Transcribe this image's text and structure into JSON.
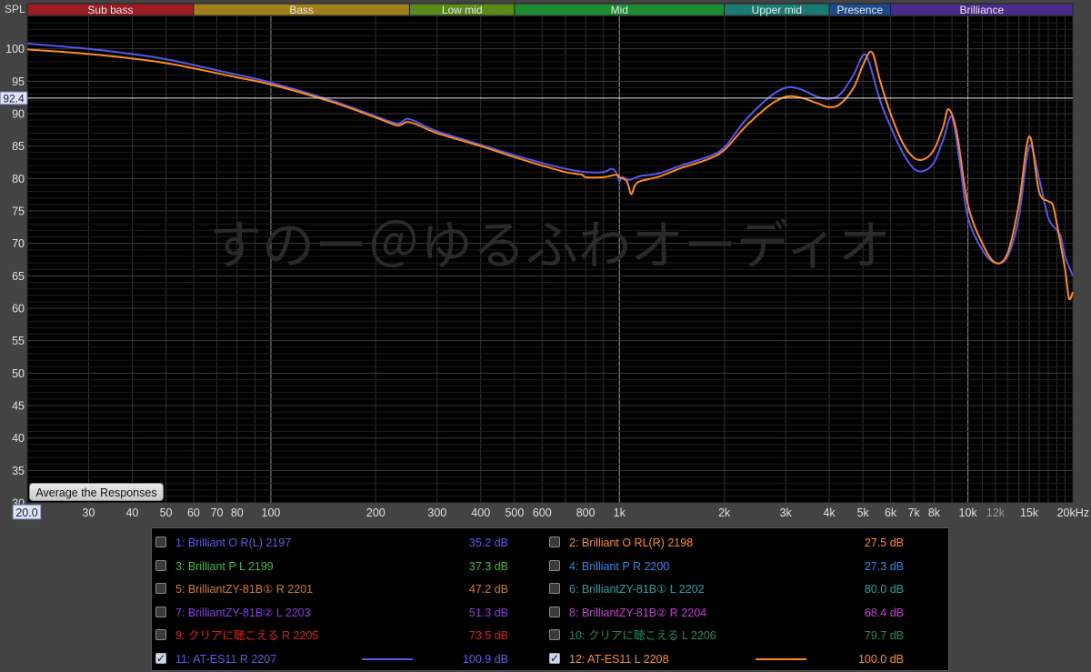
{
  "bands": [
    {
      "label": "Sub bass",
      "color": "#9c1c24",
      "from": 20,
      "to": 60
    },
    {
      "label": "Bass",
      "color": "#a0801c",
      "from": 60,
      "to": 250
    },
    {
      "label": "Low mid",
      "color": "#5a8a1a",
      "from": 250,
      "to": 500
    },
    {
      "label": "Mid",
      "color": "#1e8a32",
      "from": 500,
      "to": 2000
    },
    {
      "label": "Upper mid",
      "color": "#1c7a72",
      "from": 2000,
      "to": 4000
    },
    {
      "label": "Presence",
      "color": "#1c4a8a",
      "from": 4000,
      "to": 6000
    },
    {
      "label": "Brilliance",
      "color": "#4a2a8a",
      "from": 6000,
      "to": 20000
    }
  ],
  "avg_button_label": "Average the Responses",
  "chart_data": {
    "type": "line",
    "xlabel": "",
    "ylabel": "SPL",
    "xscale": "log",
    "xlim": [
      20,
      20000
    ],
    "ylim": [
      30,
      105
    ],
    "cursor_value": "92.4",
    "cursor_freq_label": "20.0",
    "y_ticks": [
      30,
      35,
      40,
      45,
      50,
      55,
      60,
      65,
      70,
      75,
      80,
      85,
      90,
      95,
      100
    ],
    "x_ticks": [
      {
        "v": 30,
        "t": "30"
      },
      {
        "v": 40,
        "t": "40"
      },
      {
        "v": 50,
        "t": "50"
      },
      {
        "v": 60,
        "t": "60"
      },
      {
        "v": 70,
        "t": "70"
      },
      {
        "v": 80,
        "t": "80"
      },
      {
        "v": 100,
        "t": "100"
      },
      {
        "v": 200,
        "t": "200"
      },
      {
        "v": 300,
        "t": "300"
      },
      {
        "v": 400,
        "t": "400"
      },
      {
        "v": 500,
        "t": "500"
      },
      {
        "v": 600,
        "t": "600"
      },
      {
        "v": 800,
        "t": "800"
      },
      {
        "v": 1000,
        "t": "1k"
      },
      {
        "v": 2000,
        "t": "2k"
      },
      {
        "v": 3000,
        "t": "3k"
      },
      {
        "v": 4000,
        "t": "4k"
      },
      {
        "v": 5000,
        "t": "5k"
      },
      {
        "v": 6000,
        "t": "6k"
      },
      {
        "v": 7000,
        "t": "7k"
      },
      {
        "v": 8000,
        "t": "8k"
      },
      {
        "v": 10000,
        "t": "10k"
      },
      {
        "v": 12000,
        "t": "12k"
      },
      {
        "v": 15000,
        "t": "15k"
      },
      {
        "v": 20000,
        "t": "20kHz"
      }
    ],
    "watermark": "すのー＠ゆるふわオーディオ",
    "series": [
      {
        "name": "11: AT-ES11  R 2207",
        "color": "#5555ee",
        "points": [
          [
            20,
            100.8
          ],
          [
            30,
            100
          ],
          [
            40,
            99.2
          ],
          [
            50,
            98.4
          ],
          [
            60,
            97.5
          ],
          [
            80,
            96
          ],
          [
            100,
            94.8
          ],
          [
            150,
            92
          ],
          [
            200,
            89.6
          ],
          [
            230,
            88.5
          ],
          [
            245,
            89.2
          ],
          [
            260,
            88.8
          ],
          [
            300,
            87.3
          ],
          [
            400,
            85.2
          ],
          [
            500,
            83.6
          ],
          [
            600,
            82.4
          ],
          [
            700,
            81.5
          ],
          [
            800,
            81
          ],
          [
            900,
            81
          ],
          [
            950,
            81.5
          ],
          [
            980,
            80.9
          ],
          [
            1000,
            79.6
          ],
          [
            1020,
            80.2
          ],
          [
            1070,
            79.8
          ],
          [
            1150,
            80.4
          ],
          [
            1300,
            80.8
          ],
          [
            1500,
            82
          ],
          [
            1800,
            83.4
          ],
          [
            2000,
            84.8
          ],
          [
            2300,
            89
          ],
          [
            2700,
            92.6
          ],
          [
            3000,
            94
          ],
          [
            3300,
            93.8
          ],
          [
            3700,
            92.6
          ],
          [
            4000,
            92.3
          ],
          [
            4300,
            93
          ],
          [
            4700,
            96
          ],
          [
            5000,
            99
          ],
          [
            5200,
            98
          ],
          [
            5600,
            92
          ],
          [
            6000,
            88
          ],
          [
            6500,
            84
          ],
          [
            7000,
            81.5
          ],
          [
            7500,
            81.2
          ],
          [
            8000,
            82.5
          ],
          [
            8500,
            86
          ],
          [
            9000,
            89.5
          ],
          [
            9500,
            82
          ],
          [
            10000,
            74
          ],
          [
            11000,
            69
          ],
          [
            12000,
            67
          ],
          [
            13000,
            68
          ],
          [
            14000,
            74
          ],
          [
            15000,
            85
          ],
          [
            16000,
            80
          ],
          [
            17000,
            74
          ],
          [
            18000,
            72
          ],
          [
            18500,
            71
          ],
          [
            19000,
            68
          ],
          [
            20000,
            65
          ]
        ]
      },
      {
        "name": "12: AT-ES11  L 2208",
        "color": "#ff8a1c",
        "points": [
          [
            20,
            99.9
          ],
          [
            30,
            99.2
          ],
          [
            40,
            98.5
          ],
          [
            50,
            97.8
          ],
          [
            60,
            97
          ],
          [
            80,
            95.6
          ],
          [
            100,
            94.5
          ],
          [
            150,
            91.8
          ],
          [
            200,
            89.4
          ],
          [
            230,
            88.2
          ],
          [
            245,
            88.7
          ],
          [
            260,
            88.4
          ],
          [
            300,
            87
          ],
          [
            400,
            85
          ],
          [
            500,
            83.3
          ],
          [
            600,
            82
          ],
          [
            700,
            81
          ],
          [
            780,
            80.6
          ],
          [
            800,
            80.2
          ],
          [
            900,
            80.2
          ],
          [
            980,
            80.6
          ],
          [
            1000,
            80.2
          ],
          [
            1050,
            79.6
          ],
          [
            1080,
            77.6
          ],
          [
            1110,
            79
          ],
          [
            1150,
            79.6
          ],
          [
            1300,
            80.3
          ],
          [
            1500,
            81.6
          ],
          [
            1800,
            83
          ],
          [
            2000,
            84.4
          ],
          [
            2300,
            88
          ],
          [
            2700,
            91.3
          ],
          [
            3000,
            92.6
          ],
          [
            3300,
            92.5
          ],
          [
            3700,
            91.6
          ],
          [
            4000,
            91
          ],
          [
            4300,
            91.5
          ],
          [
            4700,
            94
          ],
          [
            5000,
            97.5
          ],
          [
            5300,
            99.5
          ],
          [
            5600,
            95
          ],
          [
            6000,
            90
          ],
          [
            6500,
            85.5
          ],
          [
            7000,
            83.2
          ],
          [
            7500,
            83
          ],
          [
            8000,
            84.5
          ],
          [
            8500,
            88
          ],
          [
            8800,
            90.7
          ],
          [
            9300,
            87
          ],
          [
            10000,
            76
          ],
          [
            11000,
            70
          ],
          [
            12000,
            67
          ],
          [
            13000,
            68.5
          ],
          [
            14000,
            76
          ],
          [
            15000,
            86.5
          ],
          [
            16000,
            78
          ],
          [
            17000,
            76.5
          ],
          [
            17500,
            76
          ],
          [
            18000,
            73
          ],
          [
            19000,
            66
          ],
          [
            19500,
            61.5
          ],
          [
            20000,
            62.5
          ]
        ]
      }
    ]
  },
  "legend": {
    "entries": [
      {
        "label": "1: Brilliant O R(L) 2197",
        "value": "35.2 dB",
        "color": "#5a5aee",
        "checked": false,
        "swatch": false
      },
      {
        "label": "2: Brilliant O RL(R)  2198",
        "value": "27.5 dB",
        "color": "#ff8a1c",
        "checked": false,
        "swatch": false
      },
      {
        "label": "3: Brilliant P L 2199",
        "value": "37.3 dB",
        "color": "#3cb83c",
        "checked": false,
        "swatch": false
      },
      {
        "label": "4: Brilliant P R 2200",
        "value": "27.3 dB",
        "color": "#2a88e0",
        "checked": false,
        "swatch": false
      },
      {
        "label": "5: BrilliantZY-81B①  R 2201",
        "value": "47.2 dB",
        "color": "#d07a1a",
        "checked": false,
        "swatch": false
      },
      {
        "label": "6: BrilliantZY-81B①  L 2202",
        "value": "80.0 dB",
        "color": "#1fa0a0",
        "checked": false,
        "swatch": false
      },
      {
        "label": "7: BrilliantZY-81B②  L 2203",
        "value": "51.3 dB",
        "color": "#8a3ae0",
        "checked": false,
        "swatch": false
      },
      {
        "label": "8: BrilliantZY-81B②  R 2204",
        "value": "68.4 dB",
        "color": "#c83ad0",
        "checked": false,
        "swatch": false
      },
      {
        "label": "9: クリアに聴こえる  R 2205",
        "value": "73.5 dB",
        "color": "#d42020",
        "checked": false,
        "swatch": false
      },
      {
        "label": "10: クリアに聴こえる  L 2206",
        "value": "79.7 dB",
        "color": "#1f8a5a",
        "checked": false,
        "swatch": false
      },
      {
        "label": "11: AT-ES11  R 2207",
        "value": "100.9 dB",
        "color": "#5a5aee",
        "checked": true,
        "swatch": true
      },
      {
        "label": "12: AT-ES11  L 2208",
        "value": "100.0 dB",
        "color": "#ff8a1c",
        "checked": true,
        "swatch": true
      }
    ]
  }
}
